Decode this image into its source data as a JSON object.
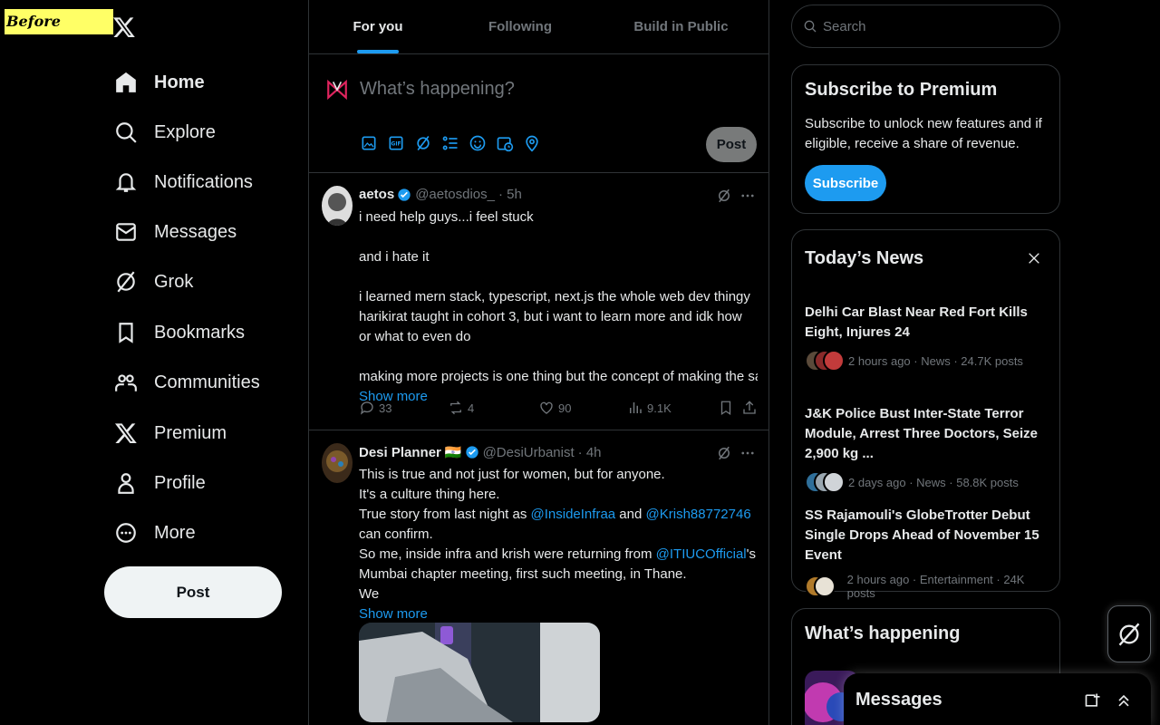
{
  "annotation": {
    "label": "Before"
  },
  "nav": {
    "items": [
      {
        "label": "Home",
        "icon": "home-icon"
      },
      {
        "label": "Explore",
        "icon": "search-icon"
      },
      {
        "label": "Notifications",
        "icon": "bell-icon"
      },
      {
        "label": "Messages",
        "icon": "envelope-icon"
      },
      {
        "label": "Grok",
        "icon": "grok-icon"
      },
      {
        "label": "Bookmarks",
        "icon": "bookmark-icon"
      },
      {
        "label": "Communities",
        "icon": "communities-icon"
      },
      {
        "label": "Premium",
        "icon": "x-logo-icon"
      },
      {
        "label": "Profile",
        "icon": "person-icon"
      },
      {
        "label": "More",
        "icon": "more-circle-icon"
      }
    ],
    "post_label": "Post"
  },
  "tabs": [
    {
      "label": "For you",
      "active": true
    },
    {
      "label": "Following",
      "active": false
    },
    {
      "label": "Build in Public",
      "active": false
    }
  ],
  "composer": {
    "placeholder": "What’s happening?",
    "post_label": "Post"
  },
  "tweets": [
    {
      "name": "aetos",
      "handle": "@aetosdios_",
      "time": "· 5h",
      "lines": [
        "i need help guys...i feel stuck",
        "",
        "and i hate it",
        "",
        "i learned mern stack, typescript, next.js the whole web dev thingy harikirat taught in cohort 3, but i want to learn more and idk how or what to even do",
        "",
        "making more projects is one thing but the concept of making the same old"
      ],
      "show_more": "Show more",
      "replies": "33",
      "reposts": "4",
      "likes": "90",
      "views": "9.1K"
    },
    {
      "name": "Desi Planner",
      "flag": "🇮🇳",
      "handle": "@DesiUrbanist",
      "time": "· 4h",
      "line1": "This is true and not just for women, but for anyone.",
      "line2": "It's a culture thing here.",
      "line3_pre": "True story from last night as ",
      "mention1": "@InsideInfraa",
      "line3_mid": " and ",
      "mention2": "@Krish88772746",
      "line3_post": " can confirm.",
      "line4_pre": "So me, inside infra and krish were returning from ",
      "mention3": "@ITIUCOfficial",
      "line4_post": "'s Mumbai chapter meeting, first such meeting, in Thane.",
      "line5": "We",
      "show_more": "Show more"
    }
  ],
  "search": {
    "placeholder": "Search"
  },
  "premium": {
    "title": "Subscribe to Premium",
    "text": "Subscribe to unlock new features and if eligible, receive a share of revenue.",
    "button": "Subscribe"
  },
  "news": {
    "title": "Today’s News",
    "items": [
      {
        "title": "Delhi Car Blast Near Red Fort Kills Eight, Injures 24",
        "meta": "2 hours ago · News · 24.7K posts"
      },
      {
        "title": "J&K Police Bust Inter-State Terror Module, Arrest Three Doctors, Seize 2,900 kg ...",
        "meta": "2 days ago · News · 58.8K posts"
      },
      {
        "title": "SS Rajamouli's GlobeTrotter Debut Single Drops Ahead of November 15 Event",
        "meta": "2 hours ago · Entertainment · 24K posts"
      }
    ]
  },
  "happening": {
    "title": "What’s happening"
  },
  "messages_drawer": {
    "title": "Messages"
  },
  "colors": {
    "accent": "#1d9bf0",
    "text": "#e7e9ea",
    "muted": "#71767b",
    "border": "#2f3336"
  }
}
